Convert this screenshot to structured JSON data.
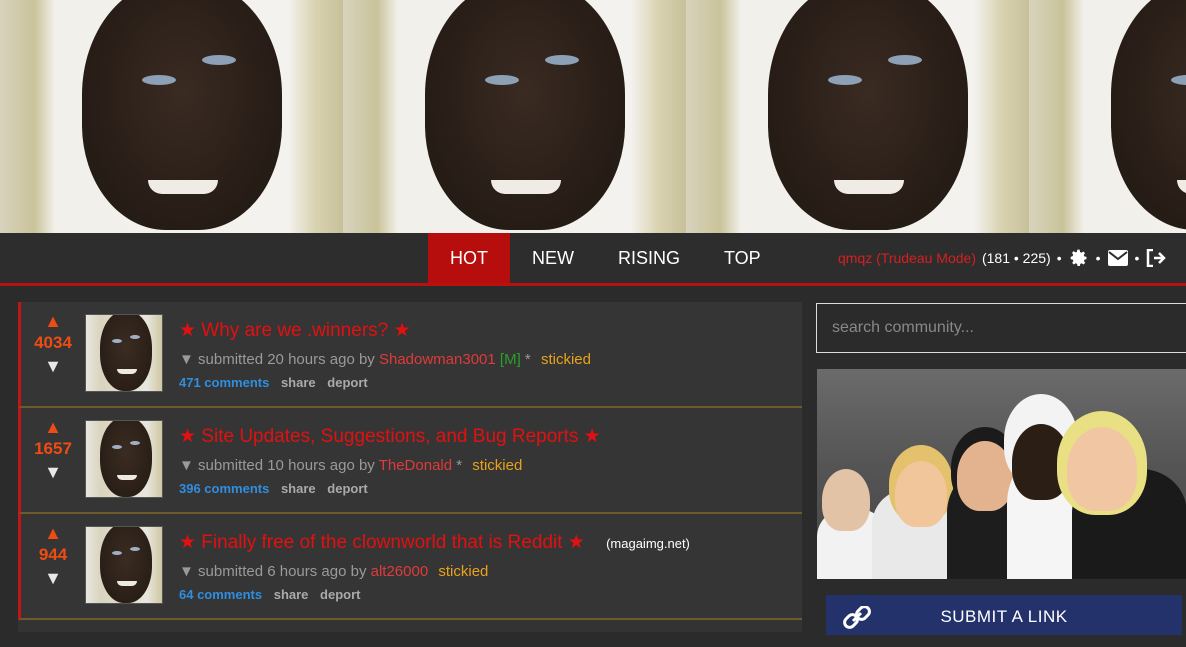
{
  "nav": {
    "tabs": [
      {
        "label": "HOT",
        "active": true
      },
      {
        "label": "NEW",
        "active": false
      },
      {
        "label": "RISING",
        "active": false
      },
      {
        "label": "TOP",
        "active": false
      }
    ],
    "username": "qmqz (Trudeau Mode)",
    "karma": "(181 • 225)",
    "separator": "•",
    "icons": [
      "gear-icon",
      "mail-icon",
      "logout-icon"
    ]
  },
  "posts": [
    {
      "score": "4034",
      "title": "★ Why are we .winners? ★",
      "domain": "",
      "meta_prefix": "▼ submitted 20 hours ago by",
      "author": "Shadowman3001",
      "mod_tag": "[M]",
      "flag": "*",
      "sticky": "stickied",
      "comments": "471 comments",
      "share": "share",
      "deport": "deport"
    },
    {
      "score": "1657",
      "title": "★ Site Updates, Suggestions, and Bug Reports ★",
      "domain": "",
      "meta_prefix": "▼ submitted 10 hours ago by",
      "author": "TheDonald",
      "mod_tag": "",
      "flag": "*",
      "sticky": "stickied",
      "comments": "396 comments",
      "share": "share",
      "deport": "deport"
    },
    {
      "score": "944",
      "title": "★ Finally free of the clownworld that is Reddit ★",
      "domain": "(magaimg.net)",
      "meta_prefix": "▼ submitted 6 hours ago by",
      "author": "alt26000",
      "mod_tag": "",
      "flag": "",
      "sticky": "stickied",
      "comments": "64 comments",
      "share": "share",
      "deport": "deport"
    }
  ],
  "sidebar": {
    "search_placeholder": "search community...",
    "submit_label": "SUBMIT A LINK"
  },
  "colors": {
    "accent": "#b60d0d",
    "title": "#e21010",
    "score": "#ef4c14",
    "comments": "#2f8ee0",
    "sticky": "#e8a21b",
    "submit": "#24326b"
  }
}
